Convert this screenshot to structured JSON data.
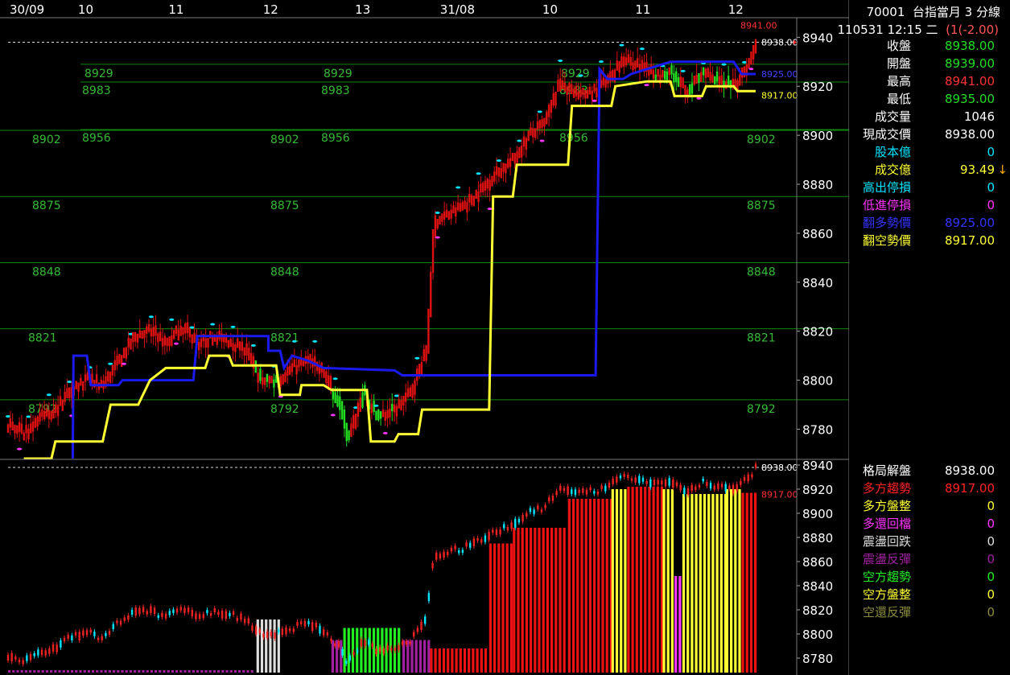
{
  "header": {
    "code": "70001",
    "name": "台指當月 3 分線",
    "datetime": "110531 12:15 二",
    "change": "(1(-2.00)"
  },
  "time_axis": [
    {
      "label": "30/09",
      "at": 0
    },
    {
      "label": "10",
      "at": 0.095
    },
    {
      "label": "11",
      "at": 0.21
    },
    {
      "label": "12",
      "at": 0.33
    },
    {
      "label": "13",
      "at": 0.447
    },
    {
      "label": "31/08",
      "at": 0.555
    },
    {
      "label": "10",
      "at": 0.685
    },
    {
      "label": "11",
      "at": 0.803
    },
    {
      "label": "12",
      "at": 0.921
    }
  ],
  "quote": [
    {
      "label": "收盤",
      "value": "8938.00",
      "vcolor": "#22dd22",
      "lcolor": "#ffffff"
    },
    {
      "label": "開盤",
      "value": "8939.00",
      "vcolor": "#22dd22",
      "lcolor": "#ffffff"
    },
    {
      "label": "最高",
      "value": "8941.00",
      "vcolor": "#ff3333",
      "lcolor": "#ffffff"
    },
    {
      "label": "最低",
      "value": "8935.00",
      "vcolor": "#22dd22",
      "lcolor": "#ffffff"
    },
    {
      "label": "成交量",
      "value": "1046",
      "vcolor": "#ffffff",
      "lcolor": "#ffffff"
    },
    {
      "label": "現成交價",
      "value": "8938.00",
      "vcolor": "#ffffff",
      "lcolor": "#ffffff"
    },
    {
      "label": "股本億",
      "value": "0",
      "vcolor": "#00e5ff",
      "lcolor": "#00e5ff"
    },
    {
      "label": "成交億",
      "value": "93.49",
      "vcolor": "#ffff33",
      "lcolor": "#ffff33"
    },
    {
      "label": "高出停損",
      "value": "0",
      "vcolor": "#00e5ff",
      "lcolor": "#00e5ff"
    },
    {
      "label": "低進停損",
      "value": "0",
      "vcolor": "#ff33ff",
      "lcolor": "#ff33ff"
    },
    {
      "label": "翻多勢價",
      "value": "8925.00",
      "vcolor": "#3333ff",
      "lcolor": "#3333ff"
    },
    {
      "label": "翻空勢價",
      "value": "8917.00",
      "vcolor": "#ffff33",
      "lcolor": "#ffff33"
    }
  ],
  "trade_arrow": "↓",
  "pattern": [
    {
      "label": "格局解盤",
      "value": "8938.00",
      "vcolor": "#ffffff",
      "lcolor": "#ffffff"
    },
    {
      "label": "多方趨勢",
      "value": "8917.00",
      "vcolor": "#ff2222",
      "lcolor": "#ff2222"
    },
    {
      "label": "多方盤整",
      "value": "0",
      "vcolor": "#ffff33",
      "lcolor": "#ffff33"
    },
    {
      "label": "多還回檔",
      "value": "0",
      "vcolor": "#ff33ff",
      "lcolor": "#ff33ff"
    },
    {
      "label": "震盪回跌",
      "value": "0",
      "vcolor": "#dddddd",
      "lcolor": "#dddddd"
    },
    {
      "label": "震盪反彈",
      "value": "0",
      "vcolor": "#a020a0",
      "lcolor": "#a020a0"
    },
    {
      "label": "空方趨勢",
      "value": "0",
      "vcolor": "#22ee22",
      "lcolor": "#22ee22"
    },
    {
      "label": "空方盤整",
      "value": "0",
      "vcolor": "#ffff33",
      "lcolor": "#ffff33"
    },
    {
      "label": "空還反彈",
      "value": "0",
      "vcolor": "#8b8b3a",
      "lcolor": "#8b8b3a"
    }
  ],
  "colors": {
    "up": "#dd1111",
    "down": "#22dd22",
    "long_line": "#1a1aee",
    "short_line": "#ffff33",
    "grid_green": "#118811",
    "level_text": "#33bb33",
    "stop_high": "#00e5ff",
    "stop_low": "#ff33ff"
  },
  "chart_data": [
    {
      "type": "line",
      "panel": "main",
      "ylim": [
        8768,
        8948
      ],
      "y_ticks": [
        8780,
        8800,
        8820,
        8840,
        8860,
        8880,
        8900,
        8920,
        8940
      ],
      "levels": [
        {
          "value": 8792,
          "label": "8792"
        },
        {
          "value": 8821,
          "label": "8821"
        },
        {
          "value": 8848,
          "label": "8848"
        },
        {
          "value": 8875,
          "label": "8875"
        },
        {
          "value": 8902,
          "label": "8902"
        },
        {
          "value": 8929,
          "label": "8929"
        },
        {
          "value": 8956,
          "label": "8956"
        },
        {
          "value": 8983,
          "label": "8983"
        }
      ],
      "last_close": {
        "value": 8938,
        "label": "8938.00"
      },
      "high_mark": {
        "value": 8941,
        "label": "8941.00"
      },
      "long_mark": {
        "value": 8925,
        "label": "8925.00"
      },
      "short_mark": {
        "value": 8917,
        "label": "8917.00"
      },
      "price_path": [
        [
          0,
          8782
        ],
        [
          0.02,
          8778
        ],
        [
          0.04,
          8785
        ],
        [
          0.06,
          8788
        ],
        [
          0.08,
          8797
        ],
        [
          0.1,
          8800
        ],
        [
          0.12,
          8798
        ],
        [
          0.14,
          8808
        ],
        [
          0.16,
          8818
        ],
        [
          0.18,
          8820
        ],
        [
          0.2,
          8815
        ],
        [
          0.22,
          8822
        ],
        [
          0.24,
          8815
        ],
        [
          0.26,
          8818
        ],
        [
          0.28,
          8816
        ],
        [
          0.3,
          8812
        ],
        [
          0.32,
          8800
        ],
        [
          0.34,
          8800
        ],
        [
          0.36,
          8805
        ],
        [
          0.38,
          8808
        ],
        [
          0.4,
          8803
        ],
        [
          0.42,
          8790
        ],
        [
          0.43,
          8775
        ],
        [
          0.45,
          8795
        ],
        [
          0.47,
          8785
        ],
        [
          0.49,
          8788
        ],
        [
          0.51,
          8795
        ],
        [
          0.53,
          8812
        ],
        [
          0.54,
          8865
        ],
        [
          0.56,
          8868
        ],
        [
          0.58,
          8872
        ],
        [
          0.6,
          8878
        ],
        [
          0.62,
          8885
        ],
        [
          0.64,
          8890
        ],
        [
          0.66,
          8900
        ],
        [
          0.68,
          8905
        ],
        [
          0.7,
          8922
        ],
        [
          0.72,
          8916
        ],
        [
          0.74,
          8918
        ],
        [
          0.76,
          8922
        ],
        [
          0.78,
          8932
        ],
        [
          0.8,
          8928
        ],
        [
          0.82,
          8924
        ],
        [
          0.84,
          8926
        ],
        [
          0.86,
          8918
        ],
        [
          0.88,
          8925
        ],
        [
          0.9,
          8922
        ],
        [
          0.92,
          8920
        ],
        [
          0.94,
          8930
        ],
        [
          0.948,
          8938
        ]
      ],
      "long_line": [
        [
          0.082,
          8768
        ],
        [
          0.083,
          8810
        ],
        [
          0.1,
          8810
        ],
        [
          0.105,
          8798
        ],
        [
          0.14,
          8798
        ],
        [
          0.145,
          8800
        ],
        [
          0.2,
          8800
        ],
        [
          0.203,
          8800
        ],
        [
          0.235,
          8800
        ],
        [
          0.24,
          8818
        ],
        [
          0.33,
          8818
        ],
        [
          0.33,
          8812
        ],
        [
          0.345,
          8812
        ],
        [
          0.35,
          8805
        ],
        [
          0.36,
          8810
        ],
        [
          0.38,
          8808
        ],
        [
          0.4,
          8805
        ],
        [
          0.49,
          8804
        ],
        [
          0.5,
          8802
        ],
        [
          0.745,
          8802
        ],
        [
          0.75,
          8927
        ],
        [
          0.76,
          8923
        ],
        [
          0.78,
          8923
        ],
        [
          0.79,
          8925
        ],
        [
          0.84,
          8930
        ],
        [
          0.92,
          8930
        ],
        [
          0.93,
          8925
        ],
        [
          0.948,
          8925
        ]
      ],
      "short_line": [
        [
          0.02,
          8768
        ],
        [
          0.055,
          8768
        ],
        [
          0.06,
          8775
        ],
        [
          0.12,
          8775
        ],
        [
          0.13,
          8790
        ],
        [
          0.165,
          8790
        ],
        [
          0.18,
          8800
        ],
        [
          0.2,
          8805
        ],
        [
          0.25,
          8805
        ],
        [
          0.255,
          8810
        ],
        [
          0.28,
          8810
        ],
        [
          0.285,
          8806
        ],
        [
          0.34,
          8806
        ],
        [
          0.345,
          8794
        ],
        [
          0.37,
          8794
        ],
        [
          0.372,
          8798
        ],
        [
          0.4,
          8798
        ],
        [
          0.41,
          8796
        ],
        [
          0.455,
          8796
        ],
        [
          0.46,
          8775
        ],
        [
          0.49,
          8775
        ],
        [
          0.495,
          8778
        ],
        [
          0.52,
          8778
        ],
        [
          0.525,
          8788
        ],
        [
          0.61,
          8788
        ],
        [
          0.615,
          8875
        ],
        [
          0.64,
          8875
        ],
        [
          0.645,
          8888
        ],
        [
          0.71,
          8888
        ],
        [
          0.715,
          8912
        ],
        [
          0.765,
          8912
        ],
        [
          0.77,
          8920
        ],
        [
          0.81,
          8922
        ],
        [
          0.84,
          8922
        ],
        [
          0.845,
          8916
        ],
        [
          0.88,
          8916
        ],
        [
          0.885,
          8920
        ],
        [
          0.92,
          8920
        ],
        [
          0.925,
          8918
        ],
        [
          0.948,
          8918
        ]
      ]
    },
    {
      "type": "bar",
      "panel": "pattern",
      "ylim": [
        8768,
        8944
      ],
      "y_ticks": [
        8780,
        8800,
        8820,
        8840,
        8860,
        8880,
        8900,
        8920,
        8940
      ],
      "last_close": {
        "value": 8938,
        "label": "8938.00"
      },
      "trend_mark": {
        "value": 8917,
        "label": "8917.00"
      },
      "segments": [
        {
          "from": 0.0,
          "to": 0.31,
          "value": 8770,
          "color": "#a020a0"
        },
        {
          "from": 0.315,
          "to": 0.345,
          "value": 8812,
          "color": "#dddddd"
        },
        {
          "from": 0.41,
          "to": 0.425,
          "value": 8795,
          "color": "#a020a0"
        },
        {
          "from": 0.425,
          "to": 0.5,
          "value": 8805,
          "color": "#22ee22"
        },
        {
          "from": 0.5,
          "to": 0.535,
          "value": 8795,
          "color": "#a020a0"
        },
        {
          "from": 0.535,
          "to": 0.61,
          "value": 8788,
          "color": "#ee1111"
        },
        {
          "from": 0.61,
          "to": 0.64,
          "value": 8875,
          "color": "#ee1111"
        },
        {
          "from": 0.64,
          "to": 0.71,
          "value": 8888,
          "color": "#ee1111"
        },
        {
          "from": 0.71,
          "to": 0.765,
          "value": 8912,
          "color": "#ee1111"
        },
        {
          "from": 0.765,
          "to": 0.785,
          "value": 8920,
          "color": "#ffff33"
        },
        {
          "from": 0.785,
          "to": 0.83,
          "value": 8922,
          "color": "#ee1111"
        },
        {
          "from": 0.83,
          "to": 0.845,
          "value": 8920,
          "color": "#ffff33"
        },
        {
          "from": 0.845,
          "to": 0.855,
          "value": 8848,
          "color": "#ff33ff"
        },
        {
          "from": 0.855,
          "to": 0.91,
          "value": 8916,
          "color": "#ffff33"
        },
        {
          "from": 0.91,
          "to": 0.93,
          "value": 8920,
          "color": "#ffff33"
        },
        {
          "from": 0.93,
          "to": 0.948,
          "value": 8917,
          "color": "#ee1111"
        }
      ]
    }
  ]
}
